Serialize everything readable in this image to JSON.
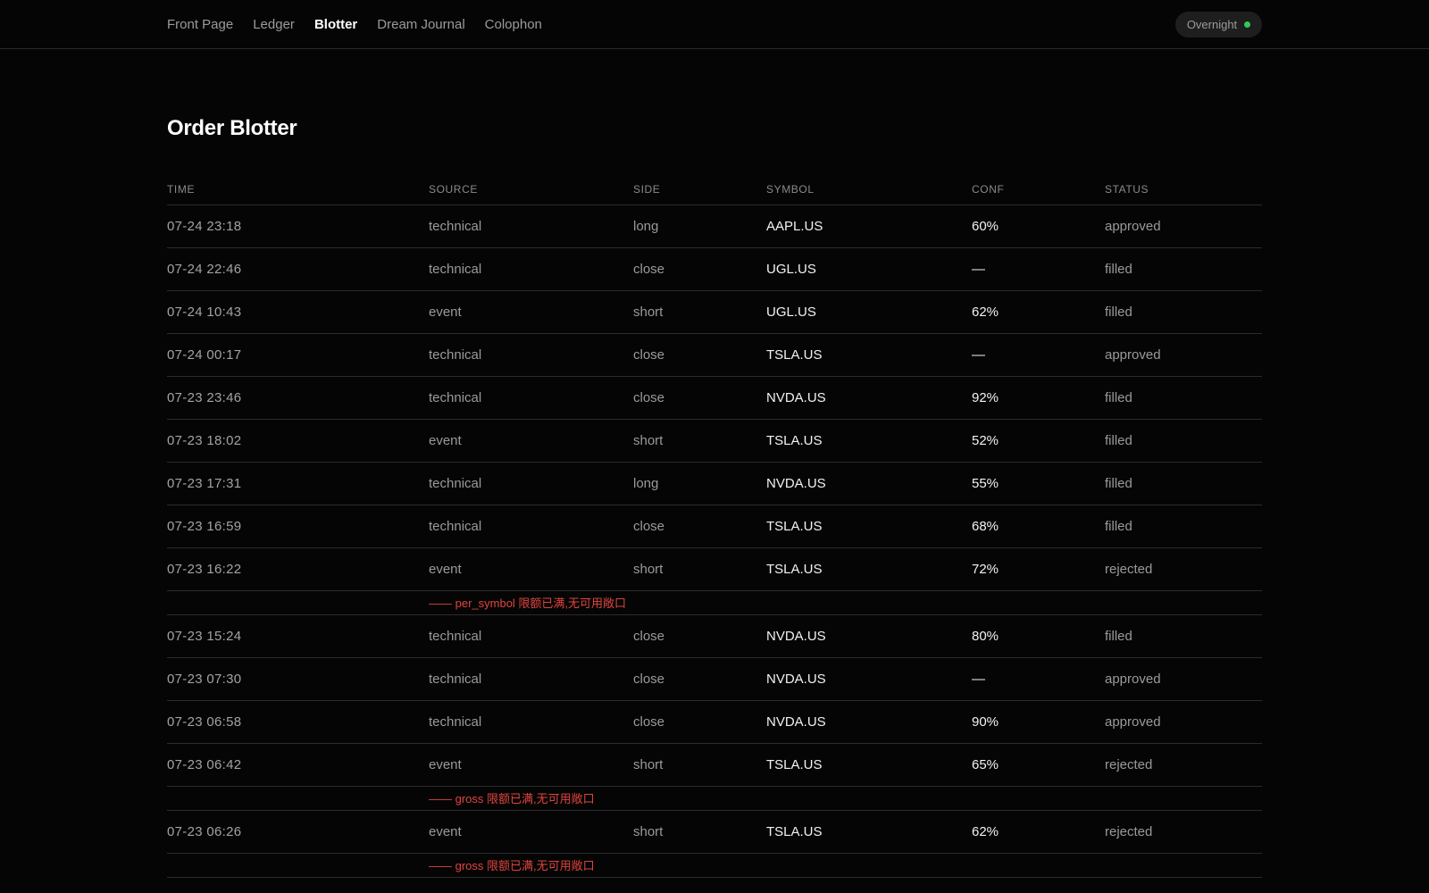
{
  "nav": {
    "items": [
      {
        "label": "Front Page",
        "active": false
      },
      {
        "label": "Ledger",
        "active": false
      },
      {
        "label": "Blotter",
        "active": true
      },
      {
        "label": "Dream Journal",
        "active": false
      },
      {
        "label": "Colophon",
        "active": false
      }
    ]
  },
  "status": {
    "label": "Overnight",
    "dot_color": "#34c759"
  },
  "page": {
    "title": "Order Blotter"
  },
  "table": {
    "columns": [
      "TIME",
      "SOURCE",
      "SIDE",
      "SYMBOL",
      "CONF",
      "STATUS"
    ],
    "rows": [
      {
        "time": "07-24 23:18",
        "source": "technical",
        "side": "long",
        "symbol": "AAPL.US",
        "conf": "60%",
        "status": "approved"
      },
      {
        "time": "07-24 22:46",
        "source": "technical",
        "side": "close",
        "symbol": "UGL.US",
        "conf": "—",
        "status": "filled"
      },
      {
        "time": "07-24 10:43",
        "source": "event",
        "side": "short",
        "symbol": "UGL.US",
        "conf": "62%",
        "status": "filled"
      },
      {
        "time": "07-24 00:17",
        "source": "technical",
        "side": "close",
        "symbol": "TSLA.US",
        "conf": "—",
        "status": "approved"
      },
      {
        "time": "07-23 23:46",
        "source": "technical",
        "side": "close",
        "symbol": "NVDA.US",
        "conf": "92%",
        "status": "filled"
      },
      {
        "time": "07-23 18:02",
        "source": "event",
        "side": "short",
        "symbol": "TSLA.US",
        "conf": "52%",
        "status": "filled"
      },
      {
        "time": "07-23 17:31",
        "source": "technical",
        "side": "long",
        "symbol": "NVDA.US",
        "conf": "55%",
        "status": "filled"
      },
      {
        "time": "07-23 16:59",
        "source": "technical",
        "side": "close",
        "symbol": "TSLA.US",
        "conf": "68%",
        "status": "filled"
      },
      {
        "time": "07-23 16:22",
        "source": "event",
        "side": "short",
        "symbol": "TSLA.US",
        "conf": "72%",
        "status": "rejected",
        "note": "—— per_symbol 限额已满,无可用敞口"
      },
      {
        "time": "07-23 15:24",
        "source": "technical",
        "side": "close",
        "symbol": "NVDA.US",
        "conf": "80%",
        "status": "filled"
      },
      {
        "time": "07-23 07:30",
        "source": "technical",
        "side": "close",
        "symbol": "NVDA.US",
        "conf": "—",
        "status": "approved"
      },
      {
        "time": "07-23 06:58",
        "source": "technical",
        "side": "close",
        "symbol": "NVDA.US",
        "conf": "90%",
        "status": "approved"
      },
      {
        "time": "07-23 06:42",
        "source": "event",
        "side": "short",
        "symbol": "TSLA.US",
        "conf": "65%",
        "status": "rejected",
        "note": "—— gross 限额已满,无可用敞口"
      },
      {
        "time": "07-23 06:26",
        "source": "event",
        "side": "short",
        "symbol": "TSLA.US",
        "conf": "62%",
        "status": "rejected",
        "note": "—— gross 限额已满,无可用敞口"
      }
    ]
  }
}
